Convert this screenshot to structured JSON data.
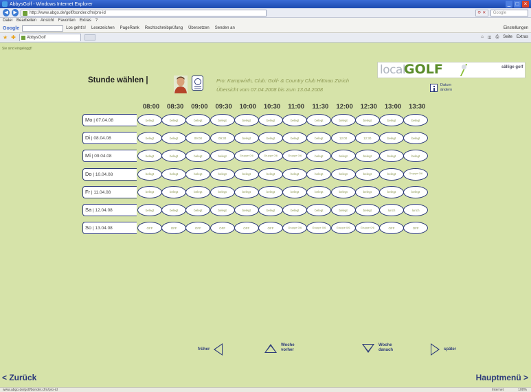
{
  "browser": {
    "window_title": "AbbysGolf - Windows Internet Explorer",
    "url": "http://www.abgo.de/golf/bonder.cfm/pro-id",
    "search_placeholder": "Google",
    "menu": [
      "Datei",
      "Bearbeiten",
      "Ansicht",
      "Favoriten",
      "Extras",
      "?"
    ],
    "google_bar": {
      "logo": "Google",
      "items": [
        "Los geht's!",
        "Lesezeichen",
        "PageRank",
        "Rechtschreibprüfung",
        "Übersetzen",
        "Senden an"
      ],
      "settings_label": "Einstellungen"
    },
    "tab_title": "AbbysGolf",
    "tab_tools": [
      "Seite",
      "Extras"
    ],
    "status_left": "www.abgo.de/golf/bonder.cfm/pro-id",
    "status_zone": "Internet",
    "status_zoom": "100%"
  },
  "page": {
    "status_note": "Sie sind eingeloggt!",
    "heading": "Stunde wählen |",
    "info_line1": "Pro: Kampwirth, Club: Golf- & Country Club Hittnau Zürich",
    "info_line2": "Übersicht vom 07.04.2008 bis zum 13.04.2008",
    "change_date_label": "Datum ändern",
    "logo": {
      "local": "local",
      "golf": "GOLF",
      "partner": "sällige golf"
    }
  },
  "schedule": {
    "times": [
      "08:00",
      "08:30",
      "09:00",
      "09:30",
      "10:00",
      "10:30",
      "11:00",
      "11:30",
      "12:00",
      "12:30",
      "13:00",
      "13:30"
    ],
    "days": [
      {
        "day": "Mo",
        "date": "07.04.08",
        "slots": [
          "belegt",
          "belegt",
          "belegt",
          "belegt",
          "belegt",
          "belegt",
          "belegt",
          "belegt",
          "belegt",
          "belegt",
          "belegt",
          "belegt"
        ]
      },
      {
        "day": "Di",
        "date": "08.04.08",
        "slots": [
          "belegt",
          "belegt",
          "09:00",
          "09:30",
          "belegt",
          "belegt",
          "belegt",
          "belegt",
          "12:00",
          "12:30",
          "belegt",
          "belegt"
        ]
      },
      {
        "day": "Mi",
        "date": "09.04.08",
        "slots": [
          "belegt",
          "belegt",
          "belegt",
          "belegt",
          "Gruppe 0/6",
          "Gruppe 0/6",
          "Gruppe 0/6",
          "belegt",
          "belegt",
          "belegt",
          "belegt",
          "belegt"
        ]
      },
      {
        "day": "Do",
        "date": "10.04.08",
        "slots": [
          "belegt",
          "belegt",
          "belegt",
          "belegt",
          "belegt",
          "belegt",
          "belegt",
          "belegt",
          "belegt",
          "belegt",
          "belegt",
          "Gruppe 0/6"
        ]
      },
      {
        "day": "Fr",
        "date": "11.04.08",
        "slots": [
          "belegt",
          "belegt",
          "belegt",
          "belegt",
          "belegt",
          "belegt",
          "belegt",
          "belegt",
          "belegt",
          "belegt",
          "belegt",
          "belegt"
        ]
      },
      {
        "day": "Sa",
        "date": "12.04.08",
        "slots": [
          "belegt",
          "belegt",
          "belegt",
          "belegt",
          "belegt",
          "belegt",
          "belegt",
          "belegt",
          "belegt",
          "belegt",
          "lunch",
          "lunch"
        ]
      },
      {
        "day": "So",
        "date": "13.04.08",
        "slots": [
          "OFF",
          "OFF",
          "OFF",
          "OFF",
          "OFF",
          "OFF",
          "Gruppe 0/6",
          "Gruppe 0/6",
          "Gruppe 0/6",
          "Gruppe 0/6",
          "OFF",
          "OFF"
        ]
      }
    ]
  },
  "navigation": {
    "earlier": "früher",
    "week_before": "Woche vorher",
    "week_after": "Woche danach",
    "later": "später",
    "back": "< Zurück",
    "main_menu": "Hauptmenü >"
  },
  "colors": {
    "background": "#d6e3a9",
    "accent_blue": "#2d3b7a",
    "slot_text": "#8f9a55",
    "logo_green": "#5a8c2a"
  }
}
